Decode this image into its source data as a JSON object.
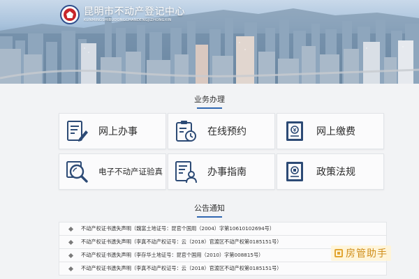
{
  "header": {
    "title": "昆明市不动产登记中心",
    "subtitle": "KUNMINGSHIBUDONGCHANDENGJIZHONGXIN",
    "logo_icon": "red-emblem-icon"
  },
  "services": {
    "section_title": "业务办理",
    "items": [
      {
        "label": "网上办事",
        "icon": "document-edit-icon"
      },
      {
        "label": "在线预约",
        "icon": "clipboard-clock-icon"
      },
      {
        "label": "网上缴费",
        "icon": "payment-document-icon"
      },
      {
        "label": "电子不动产证验真",
        "icon": "magnifier-document-icon"
      },
      {
        "label": "办事指南",
        "icon": "guide-user-icon"
      },
      {
        "label": "政策法规",
        "icon": "policy-book-icon"
      }
    ]
  },
  "notices": {
    "section_title": "公告通知",
    "items": [
      "不动产权证书遗失声明（魏富土地证号：昆官个国用（2004）字第10610102694号）",
      "不动产权证书遗失声明（李真不动产权证号：云（2018）官渡区不动产权第0185151号）",
      "不动产权证书遗失声明（李存华土地证号：昆官个国用（2010）字第008815号）",
      "不动产权证书遗失声明（李真不动产权证号：云（2018）官渡区不动产权第0185151号）"
    ]
  },
  "watermark": {
    "text": "房管助手"
  },
  "colors": {
    "accent": "#2f67b1",
    "icon_stroke": "#2c4a75",
    "page_bg": "#f2f3f5"
  }
}
